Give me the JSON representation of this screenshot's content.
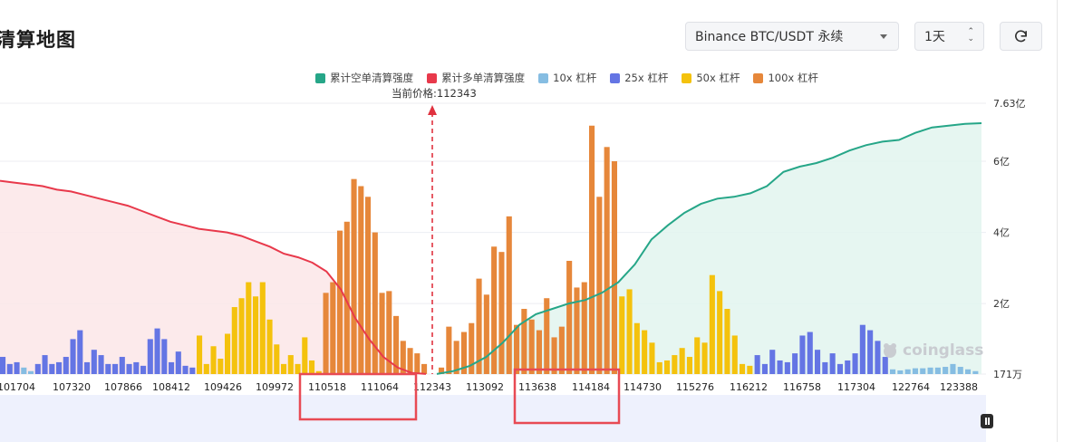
{
  "header": {
    "title": "清算地图",
    "exchange_select": "Binance BTC/USDT 永续",
    "range_select": "1天",
    "refresh_icon": "refresh-icon"
  },
  "current_price_label": "当前价格:112343",
  "watermark": "coinglass",
  "colors": {
    "cum_short": "#26a688",
    "cum_long": "#e8394b",
    "lev10": "#86bde2",
    "lev25": "#6475e4",
    "lev50": "#f4c20d",
    "lev100": "#e6873a"
  },
  "chart_data": {
    "type": "bar",
    "legend_position": "top-center",
    "series_names": [
      "累计空单清算强度",
      "累计多单清算强度",
      "10x 杠杆",
      "25x 杠杆",
      "50x 杠杆",
      "100x 杠杆"
    ],
    "x_tick_labels": [
      "101704",
      "107320",
      "107866",
      "108412",
      "109426",
      "109972",
      "110518",
      "111064",
      "112343",
      "113092",
      "113638",
      "114184",
      "114730",
      "115276",
      "116212",
      "116758",
      "117304",
      "122764",
      "123388"
    ],
    "y_tick_labels": [
      "171万",
      "2亿",
      "4亿",
      "6亿",
      "7.63亿"
    ],
    "y_ticks": [
      0.0171,
      2,
      4,
      6,
      7.63
    ],
    "ylim": [
      0.0171,
      7.63
    ],
    "current_price": 112343,
    "bar_colors": [
      "#86bde2",
      "#6475e4",
      "#f4c20d",
      "#e6873a"
    ],
    "bars_left": [
      [
        1,
        0.5
      ],
      [
        1,
        0.3
      ],
      [
        1,
        0.35
      ],
      [
        0,
        0.2
      ],
      [
        0,
        0.1
      ],
      [
        1,
        0.3
      ],
      [
        1,
        0.55
      ],
      [
        1,
        0.3
      ],
      [
        1,
        0.35
      ],
      [
        1,
        0.5
      ],
      [
        1,
        1.0
      ],
      [
        1,
        1.25
      ],
      [
        1,
        0.35
      ],
      [
        1,
        0.7
      ],
      [
        1,
        0.55
      ],
      [
        1,
        0.3
      ],
      [
        1,
        0.3
      ],
      [
        1,
        0.5
      ],
      [
        1,
        0.3
      ],
      [
        1,
        0.35
      ],
      [
        1,
        0.25
      ],
      [
        1,
        1.0
      ],
      [
        1,
        1.3
      ],
      [
        1,
        1.0
      ],
      [
        1,
        0.35
      ],
      [
        1,
        0.65
      ],
      [
        1,
        0.25
      ],
      [
        1,
        0.2
      ],
      [
        2,
        1.1
      ],
      [
        2,
        0.3
      ],
      [
        2,
        0.8
      ],
      [
        2,
        0.45
      ],
      [
        2,
        1.15
      ],
      [
        2,
        1.9
      ],
      [
        2,
        2.15
      ],
      [
        2,
        2.6
      ],
      [
        2,
        2.2
      ],
      [
        2,
        2.6
      ],
      [
        2,
        1.55
      ],
      [
        2,
        0.85
      ],
      [
        2,
        0.3
      ],
      [
        2,
        0.55
      ],
      [
        2,
        0.3
      ],
      [
        2,
        1.05
      ],
      [
        2,
        0.4
      ],
      [
        2,
        0.1
      ],
      [
        3,
        2.3
      ],
      [
        3,
        2.6
      ],
      [
        3,
        4.05
      ],
      [
        3,
        4.3
      ],
      [
        3,
        5.5
      ],
      [
        3,
        5.3
      ],
      [
        3,
        5.0
      ],
      [
        3,
        4.0
      ],
      [
        3,
        2.3
      ],
      [
        3,
        2.35
      ],
      [
        3,
        1.65
      ],
      [
        3,
        0.95
      ],
      [
        3,
        0.75
      ],
      [
        3,
        0.6
      ],
      [
        3,
        0.3
      ]
    ],
    "bars_right": [
      [
        3,
        0.2
      ],
      [
        3,
        1.35
      ],
      [
        3,
        0.95
      ],
      [
        3,
        1.2
      ],
      [
        3,
        1.45
      ],
      [
        3,
        2.7
      ],
      [
        3,
        2.25
      ],
      [
        3,
        3.6
      ],
      [
        3,
        3.45
      ],
      [
        3,
        4.45
      ],
      [
        3,
        1.4
      ],
      [
        3,
        1.85
      ],
      [
        3,
        1.55
      ],
      [
        3,
        1.25
      ],
      [
        3,
        2.15
      ],
      [
        3,
        1.05
      ],
      [
        3,
        1.35
      ],
      [
        3,
        3.2
      ],
      [
        3,
        2.45
      ],
      [
        3,
        2.6
      ],
      [
        3,
        7.0
      ],
      [
        3,
        5.0
      ],
      [
        3,
        6.4
      ],
      [
        3,
        6.0
      ],
      [
        2,
        2.2
      ],
      [
        2,
        2.4
      ],
      [
        2,
        1.45
      ],
      [
        2,
        1.25
      ],
      [
        2,
        0.9
      ],
      [
        2,
        0.35
      ],
      [
        2,
        0.4
      ],
      [
        2,
        0.55
      ],
      [
        2,
        0.75
      ],
      [
        2,
        0.5
      ],
      [
        2,
        1.05
      ],
      [
        2,
        0.9
      ],
      [
        2,
        2.8
      ],
      [
        2,
        2.35
      ],
      [
        2,
        1.85
      ],
      [
        2,
        1.1
      ],
      [
        2,
        0.3
      ],
      [
        2,
        0.25
      ],
      [
        1,
        0.55
      ],
      [
        1,
        0.3
      ],
      [
        1,
        0.7
      ],
      [
        1,
        0.4
      ],
      [
        1,
        0.35
      ],
      [
        1,
        0.6
      ],
      [
        1,
        1.1
      ],
      [
        1,
        1.2
      ],
      [
        1,
        0.7
      ],
      [
        1,
        0.35
      ],
      [
        1,
        0.6
      ],
      [
        1,
        0.3
      ],
      [
        1,
        0.4
      ],
      [
        1,
        0.6
      ],
      [
        1,
        1.4
      ],
      [
        1,
        1.25
      ],
      [
        1,
        0.95
      ],
      [
        1,
        0.5
      ],
      [
        0,
        0.15
      ],
      [
        0,
        0.12
      ],
      [
        0,
        0.15
      ],
      [
        0,
        0.18
      ],
      [
        0,
        0.18
      ],
      [
        0,
        0.2
      ],
      [
        0,
        0.2
      ],
      [
        0,
        0.22
      ],
      [
        0,
        0.3
      ],
      [
        0,
        0.22
      ],
      [
        0,
        0.15
      ],
      [
        0,
        0.1
      ]
    ],
    "cum_long_curve": [
      5.45,
      5.4,
      5.35,
      5.3,
      5.2,
      5.15,
      5.05,
      4.95,
      4.85,
      4.75,
      4.6,
      4.45,
      4.3,
      4.2,
      4.1,
      4.05,
      4.0,
      3.9,
      3.75,
      3.6,
      3.4,
      3.3,
      3.15,
      2.9,
      2.4,
      1.6,
      1.0,
      0.5,
      0.2,
      0.05,
      0.02
    ],
    "cum_short_curve": [
      0.02,
      0.1,
      0.25,
      0.5,
      0.9,
      1.4,
      1.7,
      1.85,
      2.0,
      2.1,
      2.3,
      2.6,
      3.1,
      3.8,
      4.2,
      4.55,
      4.8,
      4.95,
      5.0,
      5.1,
      5.3,
      5.7,
      5.85,
      5.95,
      6.1,
      6.3,
      6.45,
      6.55,
      6.6,
      6.8,
      6.95,
      7.0,
      7.05,
      7.07
    ]
  }
}
